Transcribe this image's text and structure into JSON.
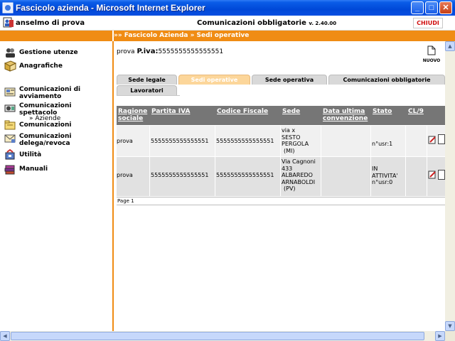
{
  "window": {
    "title": "Fascicolo azienda - Microsoft Internet Explorer",
    "min_glyph": "_",
    "max_glyph": "□",
    "close_glyph": "✕"
  },
  "header": {
    "user_label": "anselmo di prova",
    "app_title": "Comunicazioni obbligatorie",
    "version": "v. 2.40.00",
    "close_label": "CHIUDI"
  },
  "breadcrumb": "»» Fascicolo Azienda » Sedi operative",
  "sidebar": {
    "items": [
      {
        "label": "Gestione utenze",
        "icon": "users-icon"
      },
      {
        "label": "Anagrafiche",
        "icon": "book-icon"
      },
      {
        "label": "Comunicazioni di avviamento",
        "icon": "document-icon"
      },
      {
        "label": "Comunicazioni spettacolo",
        "icon": "projector-icon"
      },
      {
        "label": "Comunicazioni",
        "icon": "folder-icon"
      },
      {
        "label": "Comunicazioni delega/revoca",
        "icon": "mail-icon"
      },
      {
        "label": "Utilità",
        "icon": "tools-icon"
      },
      {
        "label": "Manuali",
        "icon": "books-icon"
      }
    ],
    "sub_item": "» Aziende"
  },
  "company": {
    "name": "prova",
    "piva_label": "P.iva:",
    "piva": "5555555555555551",
    "new_label": "NUOVO"
  },
  "tabs": [
    "Sede legale",
    "Sedi operative",
    "Sede operativa",
    "Comunicazioni obbligatorie",
    "Lavoratori"
  ],
  "table": {
    "headers": {
      "ragione": "Ragione sociale",
      "piva": "Partita IVA",
      "cf": "Codice Fiscale",
      "sede": "Sede",
      "data": "Data ultima convenzione",
      "stato": "Stato",
      "cl9": "CL/9"
    },
    "rows": [
      {
        "ragione": "prova",
        "piva": "5555555555555551",
        "cf": "5555555555555551",
        "sede": [
          "via x",
          "SESTO",
          "PERGOLA",
          "(MI)"
        ],
        "data": "",
        "stato": [
          "",
          "",
          "",
          "n°usr:1"
        ],
        "cl9": ""
      },
      {
        "ragione": "prova",
        "piva": "5555555555555551",
        "cf": "5555555555555551",
        "sede": [
          "Via Cagnoni",
          "433",
          "ALBAREDO",
          "ARNABOLDI",
          "(PV)"
        ],
        "data": "",
        "stato": [
          "IN",
          "ATTIVITA'",
          "n°usr:0"
        ],
        "cl9": ""
      }
    ],
    "pager": "Page 1"
  },
  "colors": {
    "accent_orange": "#f08c14",
    "header_gray": "#767676",
    "titlebar_blue": "#0048d8"
  }
}
